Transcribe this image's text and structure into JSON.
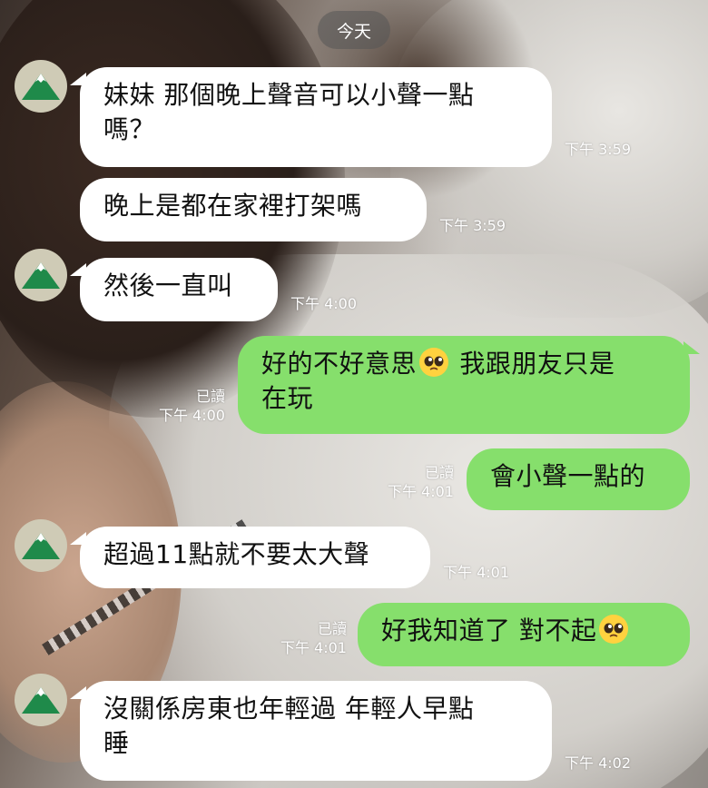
{
  "date_divider": "今天",
  "messages": [
    {
      "side": "in",
      "text": [
        "妹妹 那個晚上聲音可以小聲一點",
        "嗎？"
      ],
      "time": "下午 3:59"
    },
    {
      "side": "in",
      "text": [
        "晚上是都在家裡打架嗎"
      ],
      "time": "下午 3:59"
    },
    {
      "side": "in",
      "text": [
        "然後一直叫"
      ],
      "time": "下午 4:00"
    },
    {
      "side": "out",
      "text_a": "好的不好意思",
      "emoji": "pleading-face",
      "text_b": " 我跟朋友只是",
      "text_line2": "在玩",
      "read": "已讀",
      "time": "下午 4:00"
    },
    {
      "side": "out",
      "text": [
        "會小聲一點的"
      ],
      "read": "已讀",
      "time": "下午 4:01"
    },
    {
      "side": "in",
      "text": [
        "超過11點就不要太大聲"
      ],
      "time": "下午 4:01"
    },
    {
      "side": "out",
      "text_a": "好我知道了 對不起",
      "emoji": "pleading-face",
      "read": "已讀",
      "time": "下午 4:01"
    },
    {
      "side": "in",
      "text": [
        "沒關係房東也年輕過 年輕人早點",
        "睡"
      ],
      "time": "下午 4:02"
    }
  ],
  "colors": {
    "outgoing_bubble": "#86df6c",
    "incoming_bubble": "#ffffff",
    "avatar_bg": "#cfcbb6",
    "avatar_mountain": "#1f8a4a"
  }
}
